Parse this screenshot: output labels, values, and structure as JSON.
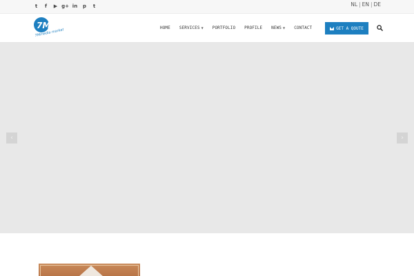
{
  "topbar": {
    "social_icons": [
      {
        "name": "twitter-icon",
        "glyph": "t"
      },
      {
        "name": "facebook-icon",
        "glyph": "f"
      },
      {
        "name": "youtube-icon",
        "glyph": "▶"
      },
      {
        "name": "google-plus-icon",
        "glyph": "g+"
      },
      {
        "name": "linkedin-icon",
        "glyph": "in"
      },
      {
        "name": "pinterest-icon",
        "glyph": "p"
      },
      {
        "name": "tumblr-icon",
        "glyph": "t"
      }
    ],
    "languages": {
      "nl": "NL",
      "separator": "|",
      "en": "EN",
      "de": "DE"
    }
  },
  "header": {
    "logo": {
      "mark": "7M",
      "tagline": "7Mmedia marketing",
      "color": "#1d7fc0"
    },
    "nav": {
      "home": "HOME",
      "services": "SERVICES",
      "portfolio": "PORTFOLIO",
      "profile": "PROFILE",
      "news": "NEWS",
      "contact": "CONTACT"
    },
    "quote_button": "GET A QOUTE",
    "accent": "#1d7fc0"
  },
  "slider": {
    "prev_glyph": "‹",
    "next_glyph": "›",
    "background": "#e8e8e8"
  }
}
